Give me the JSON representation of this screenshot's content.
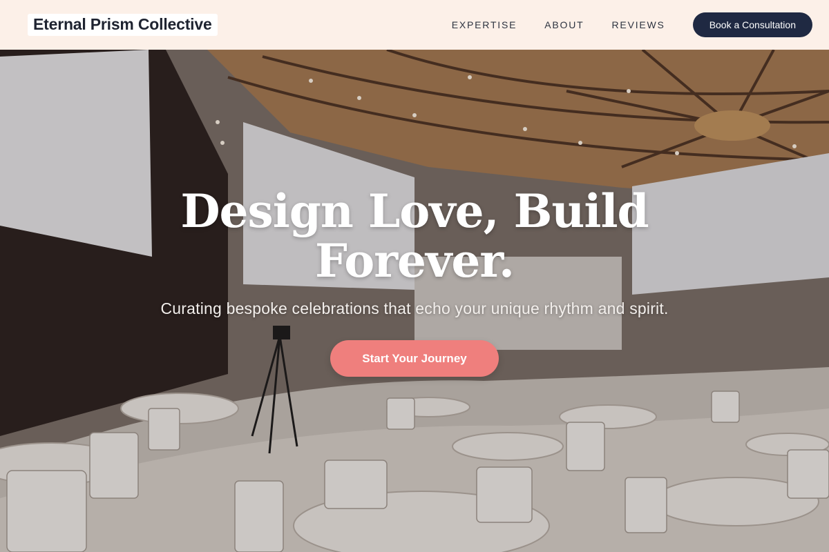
{
  "header": {
    "logo_text": "Eternal Prism Collective",
    "nav": [
      {
        "label": "EXPERTISE"
      },
      {
        "label": "ABOUT"
      },
      {
        "label": "REVIEWS"
      }
    ],
    "cta_label": "Book a Consultation"
  },
  "hero": {
    "title_line1": "Design Love, Build",
    "title_line2": "Forever.",
    "subtitle": "Curating bespoke celebrations that echo your unique rhythm and spirit.",
    "button_label": "Start Your Journey",
    "background_image": "banquet-hall-photo"
  },
  "colors": {
    "header_bg": "#fcf0e8",
    "brand_dark": "#1f2942",
    "accent_coral": "#ef7f7d"
  }
}
